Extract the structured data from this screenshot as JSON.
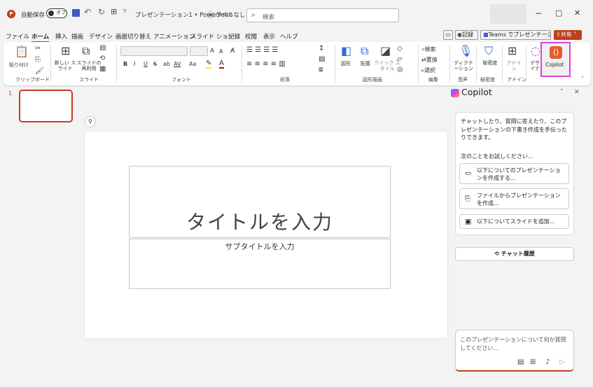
{
  "titlebar": {
    "autosave_label": "自動保存",
    "autosave_state": "オフ",
    "doc_title": "プレゼンテーション1 • PowerPoint",
    "label_text": "ラベルなし",
    "search_placeholder": "検索"
  },
  "menu": {
    "items": [
      "ファイル",
      "ホーム",
      "挿入",
      "描画",
      "デザイン",
      "画面切り替え",
      "アニメーション",
      "スライド ショー",
      "記録",
      "校閲",
      "表示",
      "ヘルプ"
    ],
    "record": "記録",
    "teams": "Teams でプレゼンテーション",
    "share": "共有"
  },
  "ribbon": {
    "paste": "貼り付け",
    "new_slide": "新しい スライド",
    "reuse_slide": "スライドの 再利用",
    "bold": "B",
    "italic": "I",
    "underline": "U",
    "strike": "S",
    "spacing": "AV",
    "case": "Aa",
    "font_grow": "A",
    "shapes": "図形",
    "arrange": "配置",
    "quick_styles": "クイック スタイル",
    "find": "検索",
    "replace": "置換",
    "select": "選択",
    "dictate": "ディクテーション",
    "sensitivity": "秘密度",
    "addins": "アドイン",
    "designer": "デザイナー",
    "copilot": "Copilot",
    "groups": {
      "clipboard": "クリップボード",
      "slides": "スライド",
      "font": "フォント",
      "paragraph": "段落",
      "drawing": "図形描画",
      "editing": "編集",
      "voice": "音声",
      "sensitivity": "秘密度",
      "addins": "アドイン"
    }
  },
  "thumbs": {
    "slide_number": "1"
  },
  "slide": {
    "title_placeholder": "タイトルを入力",
    "subtitle_placeholder": "サブタイトルを入力"
  },
  "copilot": {
    "title": "Copilot",
    "intro": "チャットしたり、質問に答えたり、このプレゼンテーションの下書き作成を手伝ったりできます。",
    "try_label": "次のことをお試しください...",
    "suggestions": [
      "以下についてのプレゼンテーションを作成する...",
      "ファイルからプレゼンテーションを作成...",
      "以下についてスライドを追加..."
    ],
    "history_button": "チャット履歴",
    "input_placeholder": "このプレゼンテーションについて何か質問してください..."
  },
  "colors": {
    "accent": "#c43e1c",
    "copilot_highlight": "#e040e0",
    "toggle": "#333333"
  }
}
